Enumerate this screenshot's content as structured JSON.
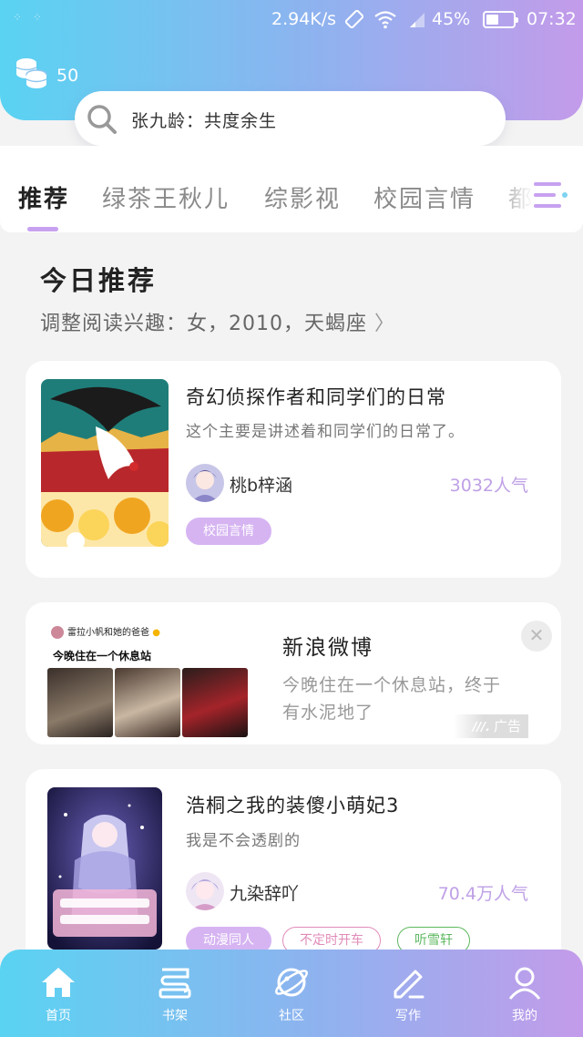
{
  "status_bar": {
    "speed": "2.94K/s",
    "battery": "45%",
    "time": "07:32"
  },
  "header": {
    "coins": "50",
    "search_placeholder": "张九龄：共度余生"
  },
  "tabs": [
    {
      "label": "推荐",
      "active": true
    },
    {
      "label": "绿茶王秋儿",
      "active": false
    },
    {
      "label": "综影视",
      "active": false
    },
    {
      "label": "校园言情",
      "active": false
    },
    {
      "label": "都",
      "active": false
    }
  ],
  "section": {
    "title": "今日推荐",
    "subtitle": "调整阅读兴趣：女，2010，天蝎座"
  },
  "books": [
    {
      "title": "奇幻侦探作者和同学们的日常",
      "desc": "这个主要是讲述着和同学们的日常了。",
      "author": "桃b梓涵",
      "popularity": "3032人气",
      "tags": [
        "校园言情"
      ]
    },
    {
      "title": "浩桐之我的装傻小萌妃3",
      "desc": "我是不会透剧的",
      "author": "九染辞吖",
      "popularity": "70.4万人气",
      "tags": [
        "动漫同人",
        "不定时开车",
        "听雪轩"
      ]
    }
  ],
  "ad": {
    "title": "新浪微博",
    "text": "今晚住在一个休息站，终于有水泥地了",
    "badge": "广告",
    "image_header": "雷拉小帆和她的爸爸",
    "image_caption": "今晚住在一个休息站"
  },
  "bottom_nav": [
    {
      "label": "首页",
      "icon": "home-icon"
    },
    {
      "label": "书架",
      "icon": "bookshelf-icon"
    },
    {
      "label": "社区",
      "icon": "planet-icon"
    },
    {
      "label": "写作",
      "icon": "pen-icon"
    },
    {
      "label": "我的",
      "icon": "user-icon"
    }
  ],
  "colors": {
    "accent": "#c7a1f0",
    "gradient_start": "#5ad3f2",
    "gradient_end": "#c39bea",
    "popularity": "#bfa0e6"
  }
}
